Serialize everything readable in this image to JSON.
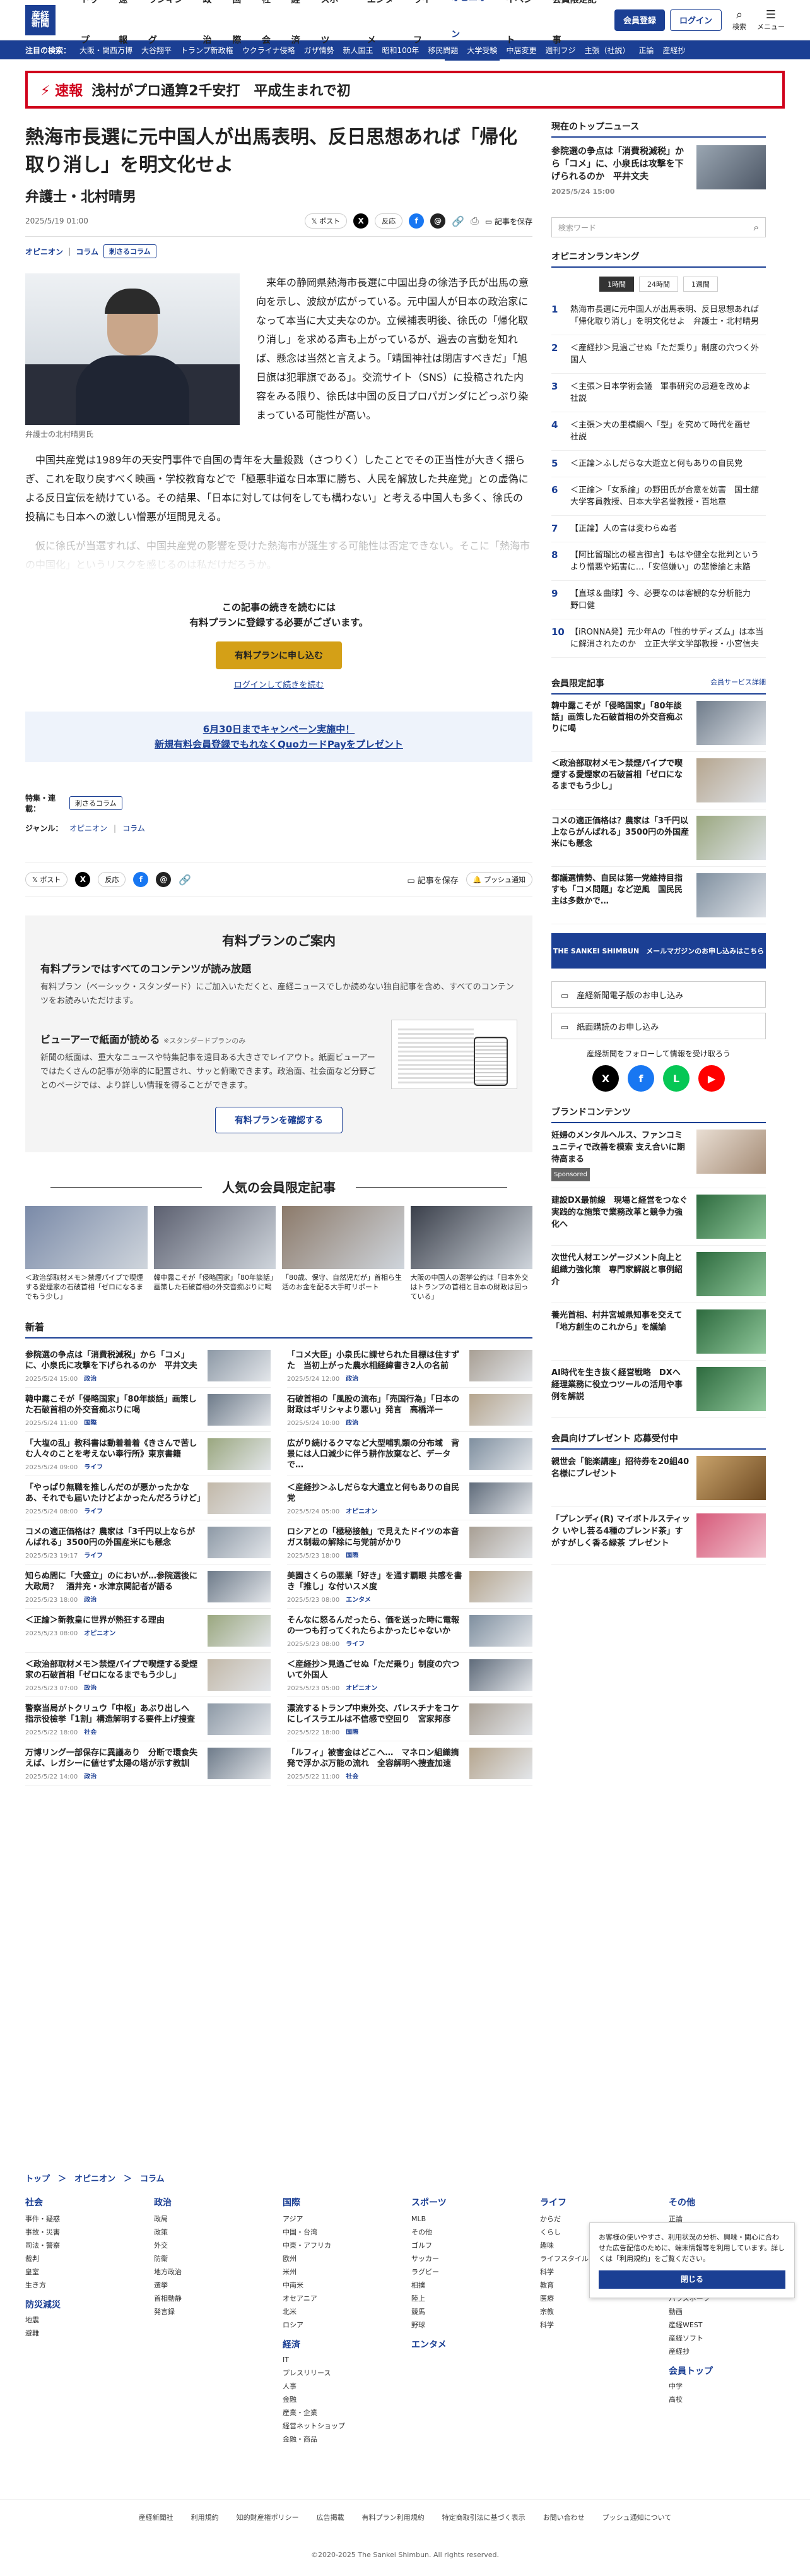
{
  "header": {
    "logo_line1": "産経",
    "logo_line2": "新聞",
    "logo_sub": "THE SANKEI SHIMBUN",
    "nav": [
      "トップ",
      "速報",
      "ランキング",
      "政治",
      "国際",
      "社会",
      "経済",
      "スポーツ",
      "エンタメ",
      "ライフ",
      "オピニオン",
      "イベント",
      "会員限定記事"
    ],
    "active": "オピニオン",
    "register": "会員登録",
    "login": "ログイン",
    "search_label": "検索",
    "menu_label": "メニュー"
  },
  "subnav": {
    "label": "注目の検索：",
    "items": [
      "大阪・関西万博",
      "大谷翔平",
      "トランプ新政権",
      "ウクライナ侵略",
      "ガザ情勢",
      "新人国王",
      "昭和100年",
      "移民問題",
      "大学受験",
      "中居変更",
      "週刊フジ",
      "主張（社説）",
      "正論",
      "産経抄"
    ]
  },
  "alert": {
    "tag": "速報",
    "text": "浅村がプロ通算2千安打　平成生まれで初"
  },
  "article": {
    "title": "熱海市長選に元中国人が出馬表明、反日思想あれば「帰化取り消し」を明文化せよ",
    "author": "弁護士・北村晴男",
    "date": "2025/5/19 01:00",
    "post": "ポスト",
    "comment": "反応",
    "save": "記事を保存",
    "category1": "オピニオン",
    "category2": "コラム",
    "badge": "刺さるコラム",
    "photo_caption": "弁護士の北村晴男氏",
    "p1": "　来年の静岡県熱海市長選に中国出身の徐浩予氏が出馬の意向を示し、波紋が広がっている。元中国人が日本の政治家になって本当に大丈夫なのか。立候補表明後、徐氏の「帰化取り消し」を求める声も上がっているが、過去の言動を知れば、懸念は当然と言えよう。「靖国神社は閉店すべきだ」「旭日旗は犯罪旗である」。交流サイト（SNS）に投稿された内容をみる限り、徐氏は中国の反日プロパガンダにどっぷり染まっている可能性が高い。",
    "p2": "　中国共産党は1989年の天安門事件で自国の青年を大量殺戮（さつりく）したことでその正当性が大きく揺らぎ、これを取り戻すべく映画・学校教育などで「極悪非道な日本軍に勝ち、人民を解放した共産党」との虚偽による反日宣伝を続けている。その結果、「日本に対しては何をしても構わない」と考える中国人も多く、徐氏の投稿にも日本への激しい憎悪が垣間見える。",
    "p3": "　仮に徐氏が当選すれば、中国共産党の影響を受けた熱海市が誕生する可能性は否定できない。そこに「熱海市の中国化」というリスクを感じるのは私だけだろうか。"
  },
  "paywall": {
    "line1": "この記事の続きを読むには",
    "line2": "有料プランに登録する必要がございます。",
    "apply": "有料プランに申し込む",
    "login": "ログインして続きを読む",
    "campaign1": "6月30日までキャンペーン実施中！",
    "campaign2": "新規有料会員登録でもれなくQuoカードPayをプレゼント"
  },
  "tags": {
    "feature_label": "特集・連載：",
    "feature": "刺さるコラム",
    "genre_label": "ジャンル：",
    "genre1": "オピニオン",
    "genre2": "コラム"
  },
  "share": {
    "post": "ポスト",
    "comment": "反応",
    "save": "記事を保存",
    "push": "プッシュ通知"
  },
  "plan": {
    "title": "有料プランのご案内",
    "h1": "有料プランではすべてのコンテンツが読み放題",
    "p1": "有料プラン（ベーシック・スタンダード）にご加入いただくと、産経ニュースでしか読めない独自記事を含め、すべてのコンテンツをお読みいただけます。",
    "h2": "ビューアーで紙面が読める",
    "h2_note": "※スタンダードプランのみ",
    "p2": "新聞の紙面は、重大なニュースや特集記事を遠目ある大きさでレイアウト。紙面ビューアーではたくさんの記事が効率的に配置され、サッと俯瞰できます。政治面、社会面など分野ごとのページでは、より詳しい情報を得ることができます。",
    "cta": "有料プランを確認する"
  },
  "popular": {
    "title": "人気の会員限定記事",
    "items": [
      "＜政治部取材メモ＞禁煙パイプで喫煙する愛煙家の石破首相「ゼロになるまでもう少し」",
      "韓中露こそが「侵略国家」「80年談話」画策した石破首相の外交音痴ぶりに喝",
      "「80歳、保守、自然児だが」首相ら生活のお金を配る大手町リポート",
      "大阪の中国人の選挙公約は「日本外交はトランプの首相と日本の財政は回っている」"
    ]
  },
  "news": {
    "title": "新着",
    "items": [
      {
        "t": "参院選の争点は「消費税減税」から「コメ」に、小泉氏に攻撃を下げられるのか　平井文夫",
        "d": "2025/5/24 15:00",
        "c": "政治"
      },
      {
        "t": "「コメ大臣」小泉氏に課せられた目標は住すずた　当初上がった農水相経緯書き2人の名前",
        "d": "2025/5/24 12:00",
        "c": "政治"
      },
      {
        "t": "韓中露こそが「侵略国家」「80年談話」画策した石破首相の外交音痴ぶりに喝",
        "d": "2025/5/24 11:00",
        "c": "国際"
      },
      {
        "t": "石破首相の「風股の流布」「売国行為」「日本の財政はギリシャより悪い」発言　高橋洋一",
        "d": "2025/5/24 10:00",
        "c": "政治"
      },
      {
        "t": "「大塩の乱」教科書は動着着着《きさんで苦しむ人々のことを考えない奉行所》東京書籍",
        "d": "2025/5/24 09:00",
        "c": "ライフ"
      },
      {
        "t": "広がり続けるクマなど大型哺乳類の分布域　背景には人口減少に伴う耕作放棄など、データで…",
        "d": "2025/5/24 08:00",
        "c": "ライフ"
      },
      {
        "t": "「やっぱり無職を推しんだのが悪かったかなあ、それでも届いたけどよかったんだろうけど」",
        "d": "2025/5/24 08:00",
        "c": "ライフ"
      },
      {
        "t": "＜産経抄＞ふしだらな大遺立と何もありの自民党",
        "d": "2025/5/24 05:00",
        "c": "オピニオン"
      },
      {
        "t": "コメの適正価格は？農家は「3千円以上ならがんばれる」3500円の外国産米にも懸念",
        "d": "2025/5/23 19:17",
        "c": "ライフ"
      },
      {
        "t": "ロシアとの「極秘接触」で見えたドイツの本音　ガス制裁の解除に与党前がかり",
        "d": "2025/5/23 18:00",
        "c": "国際"
      },
      {
        "t": "知らぬ間に「大盛立」のにおいが…参院選後に大政局？　酒井充・水津京関記者が語る",
        "d": "2025/5/23 18:00",
        "c": "政治"
      },
      {
        "t": "美園さくらの悪業「好き」を通す覇眼 共感を書き「推し」な付いスメ度",
        "d": "2025/5/23 08:00",
        "c": "エンタメ"
      },
      {
        "t": "＜正論＞新教皇に世界が熱狂する理由",
        "d": "2025/5/23 08:00",
        "c": "オピニオン"
      },
      {
        "t": "そんなに怒るんだったら、価を送った時に電報の一つも打ってくれたらよかったじゃないか",
        "d": "2025/5/23 08:00",
        "c": "ライフ"
      },
      {
        "t": "＜政治部取材メモ＞禁煙パイプで喫煙する愛煙家の石破首相「ゼロになるまでもう少し」",
        "d": "2025/5/23 07:00",
        "c": "政治"
      },
      {
        "t": "＜産経抄＞見過ごせぬ「ただ乗り」制度の穴ついて外国人",
        "d": "2025/5/23 05:00",
        "c": "オピニオン"
      },
      {
        "t": "警察当局がトクリュウ「中枢」あぶり出しへ　指示役檢挙「1割」構造解明する要件上げ捜査",
        "d": "2025/5/22 18:00",
        "c": "社会"
      },
      {
        "t": "漂流するトランプ中東外交、パレスチナをコケにしイスラエルは不信感で空回り　宮家邦彦",
        "d": "2025/5/22 18:00",
        "c": "国際"
      },
      {
        "t": "万博リング一部保存に異議あり　分断で環食失えば、レガシーに値せず太陽の塔が示す教訓",
        "d": "2025/5/22 14:00",
        "c": "政治"
      },
      {
        "t": "「ルフィ」被害金はどこへ…　マネロン組織摘発で浮かぶ万能の流れ　全容解明へ捜査加速",
        "d": "2025/5/22 11:00",
        "c": "社会"
      }
    ]
  },
  "side": {
    "top_title": "現在のトップニュース",
    "top_text": "参院選の争点は「消費税減税」から「コメ」に、小泉氏は攻撃を下げられるのか　平井文夫",
    "top_date": "2025/5/24 15:00",
    "search_placeholder": "検索ワード",
    "ranking_title": "オピニオンランキング",
    "tabs": [
      "1時間",
      "24時間",
      "1週間"
    ],
    "ranking": [
      "熱海市長選に元中国人が出馬表明、反日思想あれば「帰化取り消し」を明文化せよ　弁護士・北村晴男",
      "＜産経抄＞見過ごせぬ「ただ乗り」制度の穴つく外国人",
      "＜主張＞日本学術会議　軍事研究の忌避を改めよ　社説",
      "＜主張＞大の里横綱へ「型」を究めて時代を画せ　社説",
      "＜正論＞ふしだらな大遊立と何もありの自民党",
      "＜正論＞「女系論」の野田氏が合意を妨害　国士舘大学客員教授、日本大学名誉教授・百地章",
      "【正論】人の言は変わらぬ者",
      "【阿比留瑠比の極言御言】もはや健全な批判というより憎悪や妬害に…「安倍嫌い」の悲惨論と末路",
      "【直球＆曲球】今、必要なのは客観的な分析能力　野口健",
      "【iRONNA発】元少年Aの「性的サディズム」は本当に解消されたのか　立正大学文学部教授・小宮信夫"
    ],
    "member_title": "会員限定記事",
    "member_link": "会員サービス詳細",
    "member": [
      "韓中露こそが「侵略国家」「80年談話」画策した石破首相の外交音痴ぶりに喝",
      "＜政治部取材メモ＞禁煙パイプで喫煙する愛煙家の石破首相「ゼロになるまでもう少し」",
      "コメの適正価格は？農家は「3千円以上ならがんばれる」3500円の外国産米にも懸念",
      "都議選情勢、自民は第一党維持目指すも「コメ問題」など逆風　国民民主は多数かで…"
    ],
    "banner": "THE SANKEI SHIMBUN　メールマガジンのお申し込みはこちら",
    "link1": "産経新聞電子版のお申し込み",
    "link2": "紙面購読のお申し込み",
    "follow": "産経新聞をフォローして情報を受け取ろう",
    "brand_title": "ブランドコンテンツ",
    "brand": [
      "妊婦のメンタルヘルス、ファンコミュニティで改善を模索 支え合いに期待高まる",
      "建設DX最前線　現場と経営をつなぐ実践的な施策で業務改革と競争力強化へ",
      "次世代人材エンゲージメント向上と組織力強化策　専門家解説と事例紹介",
      "養光首相、村井宮城県知事を交えて「地方創生のこれから」を議論",
      "AI時代を生き抜く経営戦略　DXへ　経理業務に役立つツールの活用や事例を解説"
    ],
    "sponsored": "Sponsored",
    "present_title": "会員向けプレゼント 応募受付中",
    "present": [
      "親世会「能楽講座」招待券を20組40名様にプレゼント",
      "「プレンディ(R) マイボトルスティック いやし芸る4種のブレンド茶」すがすがしく香る緑茶 プレゼント"
    ]
  },
  "footer": {
    "breadcrumb": "トップ　＞　オピニオン　＞　コラム",
    "cols": [
      {
        "h": "社会",
        "items": [
          "事件・疑惑",
          "事故・災害",
          "司法・警察",
          "裁判",
          "皇室",
          "生き方"
        ],
        "h2": "防災減災",
        "items2": [
          "地震",
          "避難"
        ]
      },
      {
        "h": "政治",
        "items": [
          "政局",
          "政策",
          "外交",
          "防衛",
          "地方政治",
          "選挙",
          "首相動静",
          "発言録"
        ],
        "h2": "",
        "items2": []
      },
      {
        "h": "国際",
        "items": [
          "アジア",
          "中国・台湾",
          "中東・アフリカ",
          "欧州",
          "米州",
          "中南米",
          "オセアニア",
          "北米",
          "ロシア"
        ],
        "h2": "経済",
        "items2": [
          "IT",
          "プレスリリース",
          "人事",
          "金融",
          "産業・企業",
          "経営ネットショップ",
          "金融・商品"
        ]
      },
      {
        "h": "スポーツ",
        "items": [
          "MLB",
          "その他",
          "ゴルフ",
          "サッカー",
          "ラグビー",
          "相撲",
          "陸上",
          "競馬",
          "野球"
        ],
        "h2": "エンタメ",
        "items2": []
      },
      {
        "h": "ライフ",
        "items": [
          "からだ",
          "くらし",
          "趣味",
          "ライフスタイル",
          "科学",
          "教育",
          "医療",
          "宗教",
          "科学"
        ],
        "h2": "",
        "items2": []
      },
      {
        "h": "その他",
        "items": [
          "正論",
          "主張",
          "産経抄",
          "WEB",
          "JAPAN",
          "GO JAPAN",
          "パラスポーツ",
          "動画",
          "産経WEST",
          "産経ソフト",
          "産経抄"
        ],
        "h2": "会員トップ",
        "items2": [
          "中学",
          "高校"
        ]
      }
    ],
    "cookie_text": "お客様の使いやすさ、利用状況の分析、興味・関心に合わせた広告配信のために、端末情報等を利用しています。詳しくは「利用規約」をご覧ください。",
    "cookie_btn": "閉じる",
    "links": [
      "産経新聞社",
      "利用規約",
      "知的財産権ポリシー",
      "広告掲載",
      "有料プラン利用規約",
      "特定商取引法に基づく表示",
      "お問い合わせ",
      "プッシュ通知について"
    ],
    "copyright": "©2020-2025 The Sankei Shimbun. All rights reserved."
  },
  "colors": {
    "brand": "#1b3f94",
    "alert": "#d0021b",
    "gold": "#d4a017"
  }
}
